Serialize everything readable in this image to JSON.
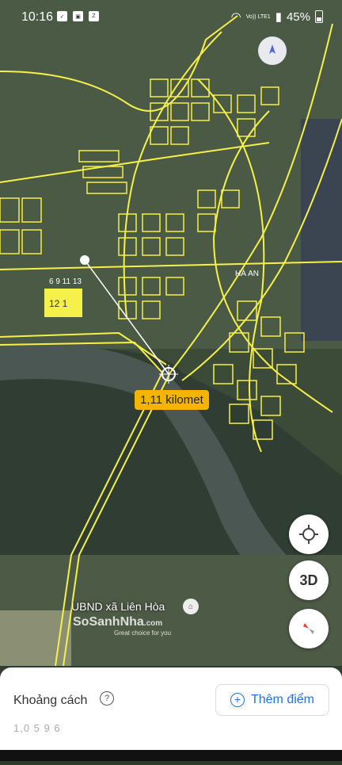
{
  "status": {
    "time": "10:16",
    "notif_icons": [
      "check-icon",
      "gallery-icon",
      "zalo-icon"
    ],
    "network": "Vo)) LTE1",
    "battery": "45%"
  },
  "map": {
    "measurement_label": "1,11 kilomet",
    "area_label": "HÀ AN",
    "plot_label": "12 1",
    "plot_numbers": "6 9 11 13",
    "place_label": "UBND xã Liên Hòa",
    "watermark": "SoSanhNha",
    "watermark_domain": ".com",
    "watermark_tagline": "Great choice for you",
    "road_color": "#f6f04a",
    "accent_color": "#f4b400"
  },
  "controls": {
    "locate": "crosshair-icon",
    "three_d_label": "3D",
    "compass": "compass-icon"
  },
  "sheet": {
    "title": "Khoảng cách",
    "add_point_label": "Thêm điểm",
    "distance_value": "1,0 5 9 6"
  }
}
